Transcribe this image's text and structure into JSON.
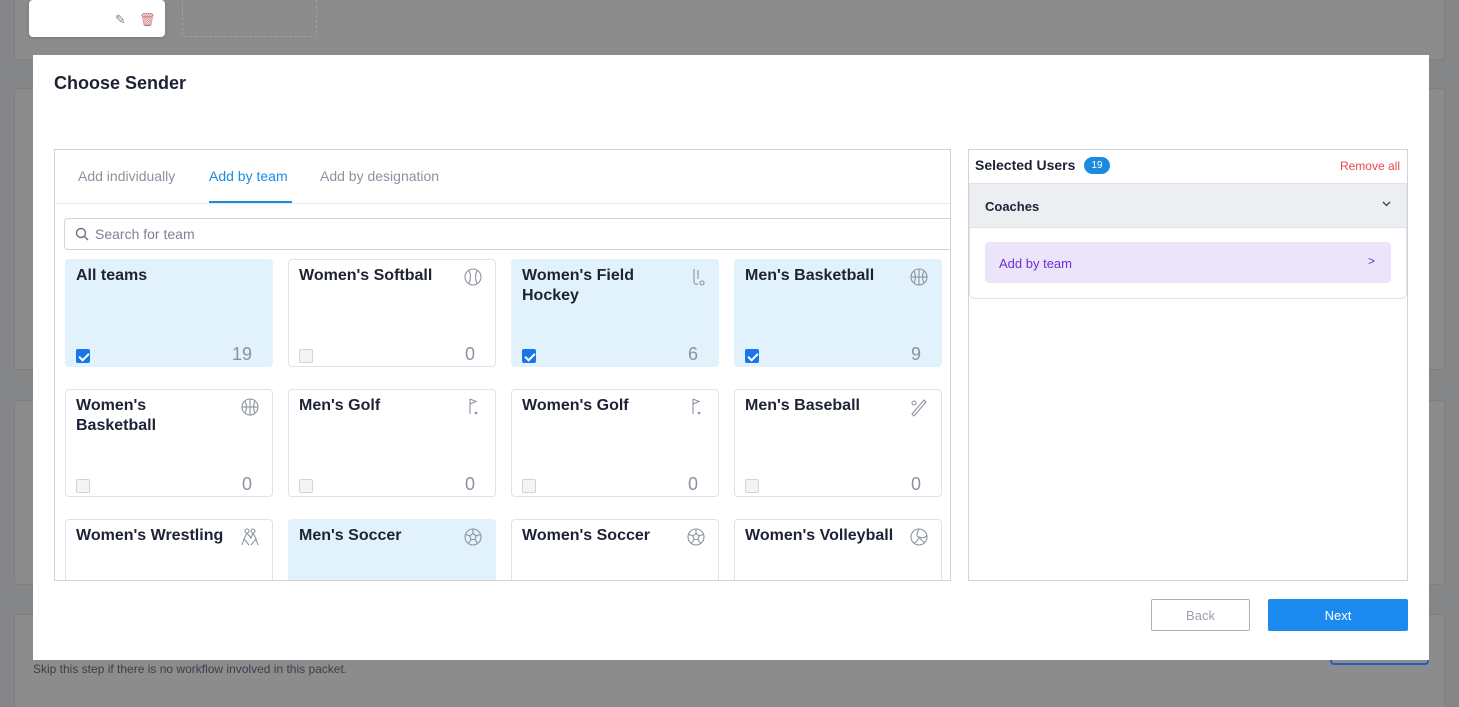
{
  "background": {
    "skip_text": "Skip this step if there is no workflow involved in this packet."
  },
  "modal": {
    "title": "Choose Sender",
    "tabs": [
      {
        "label": "Add individually",
        "active": false
      },
      {
        "label": "Add by team",
        "active": true
      },
      {
        "label": "Add by designation",
        "active": false
      }
    ],
    "search": {
      "placeholder": "Search for team",
      "value": ""
    },
    "teams": [
      {
        "name": "All teams",
        "icon": "none",
        "selected": true,
        "count": "19"
      },
      {
        "name": "Women's Softball",
        "icon": "softball-icon",
        "selected": false,
        "count": "0"
      },
      {
        "name": "Women's Field Hockey",
        "icon": "field-hockey-icon",
        "selected": true,
        "count": "6"
      },
      {
        "name": "Men's Basketball",
        "icon": "basketball-icon",
        "selected": true,
        "count": "9"
      },
      {
        "name": "Women's Basketball",
        "icon": "basketball-icon",
        "selected": false,
        "count": "0"
      },
      {
        "name": "Men's Golf",
        "icon": "golf-icon",
        "selected": false,
        "count": "0"
      },
      {
        "name": "Women's Golf",
        "icon": "golf-icon",
        "selected": false,
        "count": "0"
      },
      {
        "name": "Men's Baseball",
        "icon": "baseball-bat-icon",
        "selected": false,
        "count": "0"
      },
      {
        "name": "Women's Wrestling",
        "icon": "wrestling-icon",
        "selected": false,
        "count": ""
      },
      {
        "name": "Men's Soccer",
        "icon": "soccer-ball-icon",
        "selected": true,
        "count": ""
      },
      {
        "name": "Women's Soccer",
        "icon": "soccer-ball-icon",
        "selected": false,
        "count": ""
      },
      {
        "name": "Women's Volleyball",
        "icon": "volleyball-icon",
        "selected": false,
        "count": ""
      }
    ],
    "selected_users": {
      "title": "Selected Users",
      "count": "19",
      "remove_all": "Remove all",
      "group_label": "Coaches",
      "group_chevron": "chevron-down-icon",
      "sub_item_label": "Add by team",
      "sub_item_arrow": ">"
    },
    "buttons": {
      "back": "Back",
      "next": "Next"
    },
    "colors": {
      "accent": "#1b8be0",
      "selected_card": "#e1f2fc",
      "remove": "#e5484d",
      "sub_item_bg": "#ece4fb",
      "sub_item_text": "#6b2fd6"
    }
  }
}
